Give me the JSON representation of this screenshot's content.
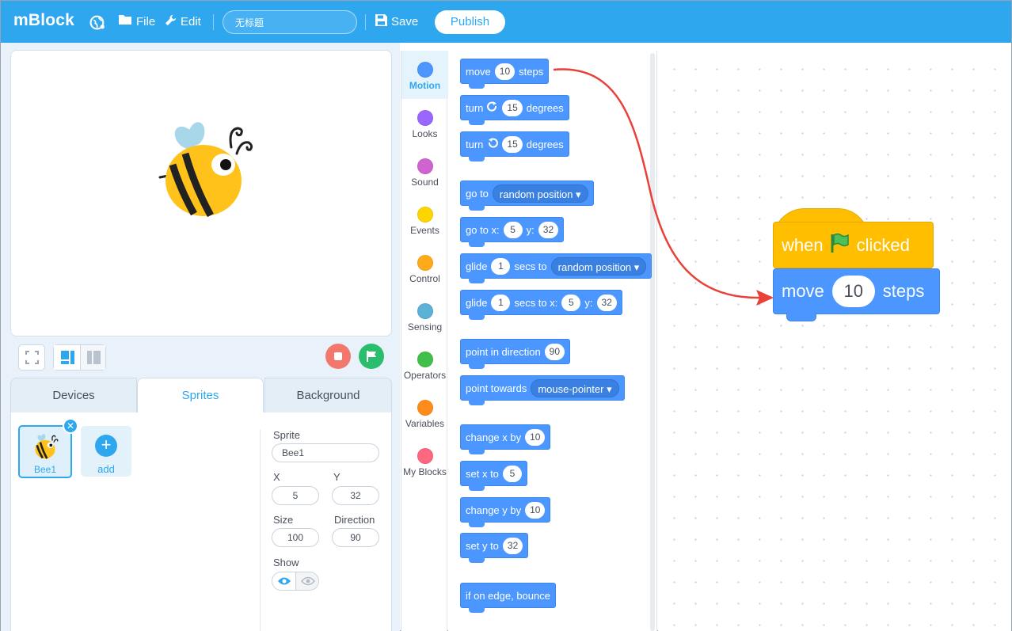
{
  "topbar": {
    "brand": "mBlock",
    "file_label": "File",
    "edit_label": "Edit",
    "project_title": "无标题",
    "save_label": "Save",
    "publish_label": "Publish",
    "accent": "#2ea7ef"
  },
  "stage": {
    "sprite_icon": "bee-sprite",
    "controls": {
      "stop_color": "#f2786e",
      "go_color": "#2bbd6e"
    }
  },
  "tabs": {
    "devices": "Devices",
    "sprites": "Sprites",
    "background": "Background",
    "active": "Sprites"
  },
  "sprites": {
    "items": [
      {
        "name": "Bee1"
      }
    ],
    "add_label": "add"
  },
  "properties": {
    "sprite_label": "Sprite",
    "sprite_name": "Bee1",
    "x_label": "X",
    "x_value": "5",
    "y_label": "Y",
    "y_value": "32",
    "size_label": "Size",
    "size_value": "100",
    "direction_label": "Direction",
    "direction_value": "90",
    "show_label": "Show"
  },
  "categories": [
    {
      "label": "Motion",
      "color": "#4c97ff"
    },
    {
      "label": "Looks",
      "color": "#9966ff"
    },
    {
      "label": "Sound",
      "color": "#cf63cf"
    },
    {
      "label": "Events",
      "color": "#ffd500"
    },
    {
      "label": "Control",
      "color": "#ffab19"
    },
    {
      "label": "Sensing",
      "color": "#5cb1d6"
    },
    {
      "label": "Operators",
      "color": "#40bf4a"
    },
    {
      "label": "Variables",
      "color": "#ff8c1a"
    },
    {
      "label": "My Blocks",
      "color": "#ff6680"
    }
  ],
  "palette": {
    "move": {
      "a": "move",
      "v": "10",
      "b": "steps"
    },
    "turn_cw": {
      "a": "turn",
      "v": "15",
      "b": "degrees"
    },
    "turn_ccw": {
      "a": "turn",
      "v": "15",
      "b": "degrees"
    },
    "goto": {
      "a": "go to",
      "dd": "random position"
    },
    "goto_xy": {
      "a": "go to x:",
      "x": "5",
      "b": "y:",
      "y": "32"
    },
    "glide": {
      "a": "glide",
      "v": "1",
      "b": "secs to",
      "dd": "random position"
    },
    "glide_xy": {
      "a": "glide",
      "v": "1",
      "b": "secs to x:",
      "x": "5",
      "c": "y:",
      "y": "32"
    },
    "point_dir": {
      "a": "point in direction",
      "v": "90"
    },
    "point_towards": {
      "a": "point towards",
      "dd": "mouse-pointer"
    },
    "change_x": {
      "a": "change x by",
      "v": "10"
    },
    "set_x": {
      "a": "set x to",
      "v": "5"
    },
    "change_y": {
      "a": "change y by",
      "v": "10"
    },
    "set_y": {
      "a": "set y to",
      "v": "32"
    },
    "bounce": {
      "a": "if on edge, bounce"
    }
  },
  "workspace": {
    "hat": {
      "a": "when",
      "b": "clicked"
    },
    "move": {
      "a": "move",
      "v": "10",
      "b": "steps"
    }
  }
}
